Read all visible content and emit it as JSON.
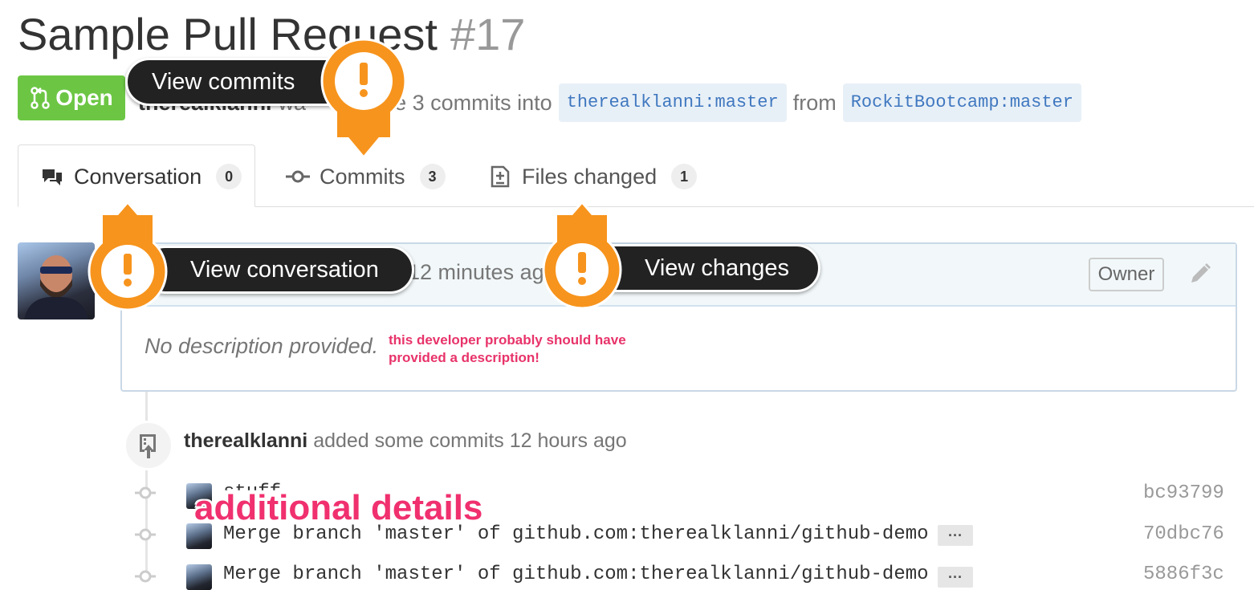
{
  "pr": {
    "title": "Sample Pull Request",
    "number": "#17",
    "state": "Open",
    "author": "therealklanni",
    "merge_text_visible": "wa",
    "merge_text_tail": "rge 3 commits into",
    "base_branch": "therealklanni:master",
    "from_label": "from",
    "head_branch": "RockitBootcamp:master"
  },
  "tabs": [
    {
      "label": "Conversation",
      "count": "0"
    },
    {
      "label": "Commits",
      "count": "3"
    },
    {
      "label": "Files changed",
      "count": "1"
    }
  ],
  "comment": {
    "time_text": "12 minutes ago",
    "owner_label": "Owner",
    "body": "No description provided."
  },
  "annotations": {
    "view_commits": "View commits",
    "view_conversation": "View conversation",
    "view_changes": "View changes",
    "note_line1": "this developer probably should have",
    "note_line2": "provided a description!",
    "additional_details": "additional details",
    "accent_color": "#f7941d"
  },
  "timeline": {
    "event_author": "therealklanni",
    "event_text": "added some commits 12 hours ago",
    "commits": [
      {
        "message": "stuff",
        "sha": "bc93799"
      },
      {
        "message": "Merge branch 'master' of github.com:therealklanni/github-demo",
        "sha": "70dbc76",
        "more": "···"
      },
      {
        "message": "Merge branch 'master' of github.com:therealklanni/github-demo",
        "sha": "5886f3c",
        "more": "···"
      }
    ]
  },
  "colors": {
    "open_green": "#6cc644",
    "annotation_pink": "#f0306f",
    "callout_orange": "#f7941d",
    "branch_blue": "#4078c0"
  }
}
